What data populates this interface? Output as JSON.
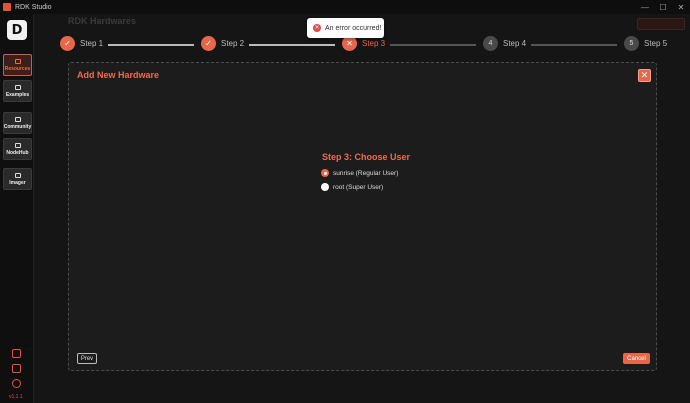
{
  "app": {
    "title": "RDK Studio"
  },
  "window_controls": {
    "minimize": "—",
    "maximize": "☐",
    "close": "✕"
  },
  "brand": {
    "letter": "D"
  },
  "sidebar": {
    "items": [
      {
        "label": "Resources",
        "active": true
      },
      {
        "label": "Examples",
        "active": false
      },
      {
        "label": "Community",
        "active": false
      },
      {
        "label": "NodeHub",
        "active": false
      },
      {
        "label": "Imager",
        "active": false
      }
    ],
    "version": "v1.1.1"
  },
  "page": {
    "title": "RDK Hardwares"
  },
  "toast": {
    "icon": "error-icon",
    "message": "An error occurred!"
  },
  "stepper": {
    "steps": [
      {
        "label": "Step 1",
        "status": "done",
        "mark": "✓"
      },
      {
        "label": "Step 2",
        "status": "done",
        "mark": "✓"
      },
      {
        "label": "Step 3",
        "status": "error",
        "mark": "✕"
      },
      {
        "label": "Step 4",
        "status": "pending",
        "mark": "4"
      },
      {
        "label": "Step 5",
        "status": "pending",
        "mark": "5"
      }
    ]
  },
  "dialog": {
    "title": "Add New Hardware",
    "close_icon": "✕",
    "step_heading": "Step 3: Choose User",
    "options": [
      {
        "label": "sunrise (Regular User)",
        "checked": true
      },
      {
        "label": "root (Super User)",
        "checked": false
      }
    ],
    "prev_label": "Prev",
    "cancel_label": "Cancel"
  },
  "colors": {
    "accent": "#e8674a",
    "background": "#151515",
    "dialog_bg": "#1c1c1c"
  }
}
